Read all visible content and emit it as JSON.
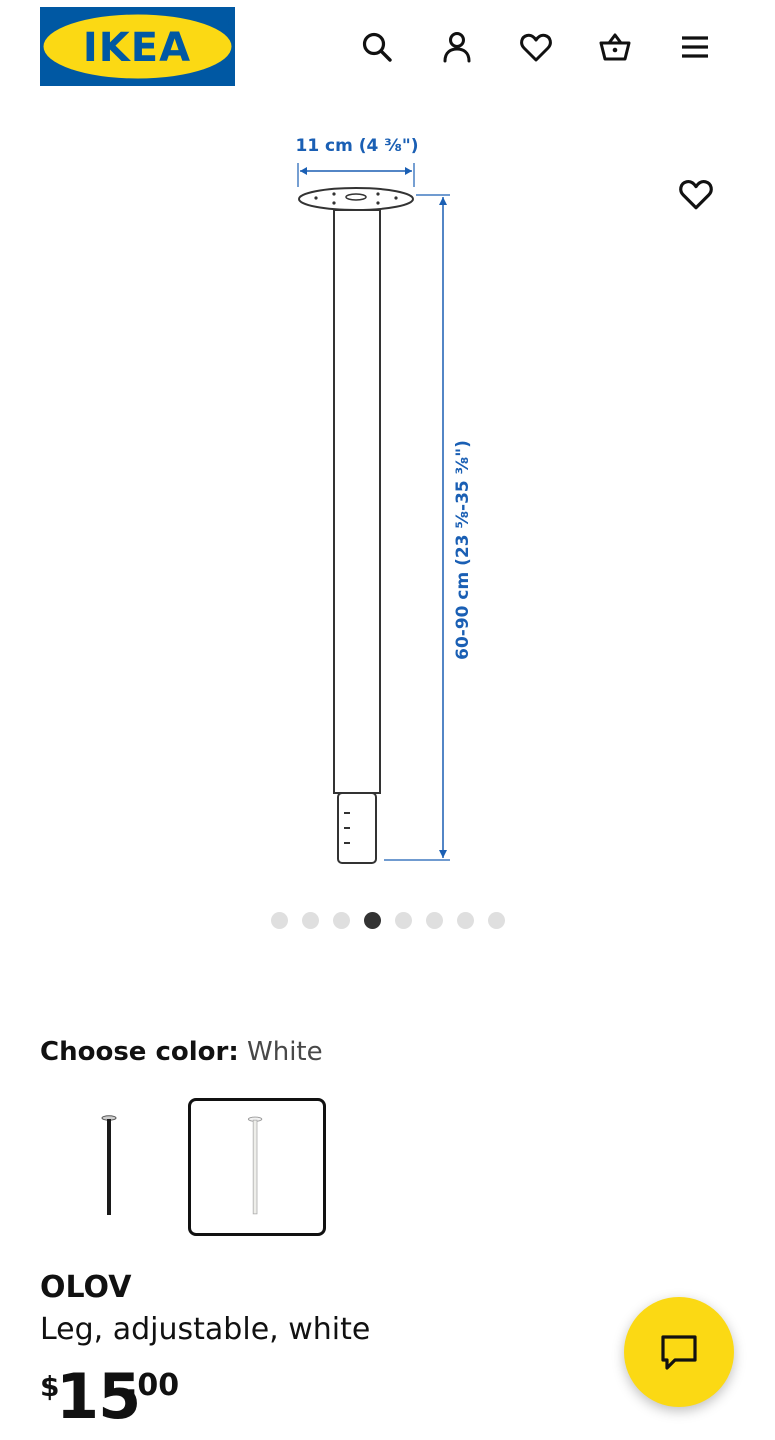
{
  "header": {
    "logo_text": "IKEA",
    "icons": [
      "search-icon",
      "account-icon",
      "heart-icon",
      "basket-icon",
      "menu-icon"
    ]
  },
  "gallery": {
    "dimension_width": "11 cm (4 ⅜\")",
    "dimension_height": "60-90 cm (23 ⅝-35 ⅜\")",
    "dot_count": 8,
    "active_dot": 4
  },
  "color": {
    "label": "Choose color:",
    "value": "White",
    "options": [
      "Black",
      "White"
    ]
  },
  "product": {
    "name": "OLOV",
    "description": "Leg, adjustable, white",
    "price_currency": "$",
    "price_int": "15",
    "price_dec": ".00"
  },
  "colors": {
    "ikea_blue": "#0058a3",
    "ikea_yellow": "#fbd914",
    "dimension_blue": "#1a5fb4"
  }
}
